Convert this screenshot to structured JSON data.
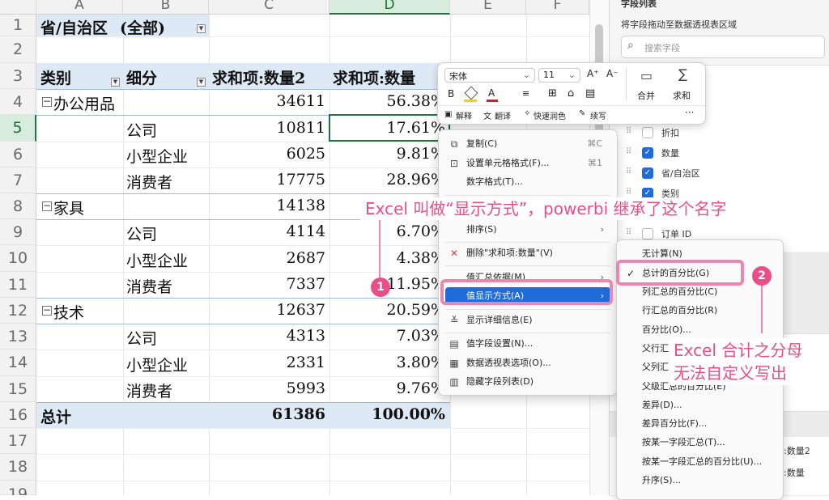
{
  "columns": [
    "A",
    "B",
    "C",
    "D",
    "E",
    "F"
  ],
  "rows": [
    "1",
    "2",
    "3",
    "4",
    "5",
    "6",
    "7",
    "8",
    "9",
    "10",
    "11",
    "12",
    "13",
    "14",
    "15",
    "16",
    "17",
    "18",
    "19"
  ],
  "pivot": {
    "filter_label": "省/自治区",
    "filter_value": "(全部)",
    "headers": {
      "category": "类别",
      "segment": "细分",
      "sum2": "求和项:数量2",
      "sum": "求和项:数量"
    },
    "groups": [
      {
        "name": "办公用品",
        "total": "34611",
        "pct": "56.38%",
        "rows": [
          {
            "seg": "公司",
            "qty": "10811",
            "pct": "17.61%"
          },
          {
            "seg": "小型企业",
            "qty": "6025",
            "pct": "9.81%"
          },
          {
            "seg": "消费者",
            "qty": "17775",
            "pct": "28.96%"
          }
        ]
      },
      {
        "name": "家具",
        "total": "14138",
        "pct": "",
        "rows": [
          {
            "seg": "公司",
            "qty": "4114",
            "pct": "6.70%"
          },
          {
            "seg": "小型企业",
            "qty": "2687",
            "pct": "4.38%"
          },
          {
            "seg": "消费者",
            "qty": "7337",
            "pct": "11.95%"
          }
        ]
      },
      {
        "name": "技术",
        "total": "12637",
        "pct": "20.59%",
        "rows": [
          {
            "seg": "公司",
            "qty": "4313",
            "pct": "7.03%"
          },
          {
            "seg": "小型企业",
            "qty": "2331",
            "pct": "3.80%"
          },
          {
            "seg": "消费者",
            "qty": "5993",
            "pct": "9.76%"
          }
        ]
      }
    ],
    "grand": {
      "label": "总计",
      "qty": "61386",
      "pct": "100.00%"
    }
  },
  "panel": {
    "title": "字段列表",
    "subtitle": "将字段拖动至数据透视表区域",
    "search_placeholder": "搜索字段",
    "fields": [
      {
        "name": "折扣",
        "checked": false
      },
      {
        "name": "数量",
        "checked": true
      },
      {
        "name": "省/自治区",
        "checked": true
      },
      {
        "name": "类别",
        "checked": true
      },
      {
        "name": "订单 ID",
        "checked": false
      }
    ],
    "bottom_items": [
      ":数量2",
      ":数量"
    ]
  },
  "toolbar": {
    "font": "宋体",
    "size": "11",
    "grow": "A⁺",
    "shrink": "A⁻",
    "bold": "B",
    "merge": "合并",
    "sum": "求和",
    "more": "···",
    "explain": "解释",
    "translate": "翻译",
    "quick_color": "快速润色",
    "continue": "续写"
  },
  "context_menu": {
    "copy": "复制(C)",
    "copy_sc": "⌘C",
    "format_cells": "设置单元格格式(F)...",
    "format_sc": "⌘1",
    "number_format": "数字格式(T)...",
    "sort": "排序(S)",
    "delete": "删除\"求和项:数量\"(V)",
    "summarize": "值汇总依据(M)",
    "show_as": "值显示方式(A)",
    "details": "显示详细信息(E)",
    "field_settings": "值字段设置(N)...",
    "pivot_options": "数据透视表选项(O)...",
    "hide_list": "隐藏字段列表(D)"
  },
  "submenu": {
    "items": [
      "无计算(N)",
      "总计的百分比(G)",
      "列汇总的百分比(C)",
      "行汇总的百分比(R)",
      "百分比(O)...",
      "父行汇",
      "父列汇",
      "父级汇总的百分比(E)",
      "差异(D)...",
      "差异百分比(F)...",
      "按某一字段汇总(T)...",
      "按某一字段汇总的百分比(U)...",
      "升序(S)..."
    ],
    "checked_index": 1
  },
  "annotations": {
    "note1": "Excel 叫做“显示方式”，powerbi 继承了这个名字",
    "note2_line1": "Excel 合计之分母",
    "note2_line2": "无法自定义写出",
    "badge1": "1",
    "badge2": "2"
  },
  "colors": {
    "accent_pink": "#ea4c86",
    "menu_highlight": "#1f6bd9",
    "excel_green": "#217346"
  }
}
